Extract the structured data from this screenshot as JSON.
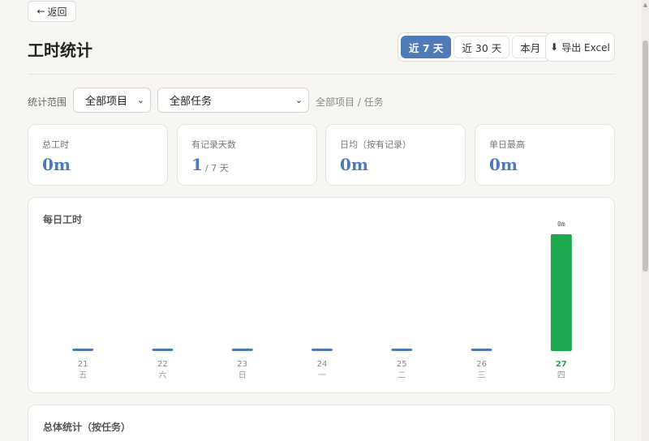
{
  "header": {
    "back_label": "返回",
    "title": "工时统计",
    "range_options": [
      "近 7 天",
      "近 30 天",
      "本月"
    ],
    "active_range": "近 7 天",
    "export_label": "导出 Excel"
  },
  "filters": {
    "label": "统计范围",
    "project_value": "全部项目",
    "task_value": "全部任务",
    "crumb": "全部项目 / 任务"
  },
  "stats": {
    "total": {
      "label": "总工时",
      "value": "0m"
    },
    "days": {
      "label": "有记录天数",
      "value": "1",
      "suffix": "/ 7 天"
    },
    "daily_avg": {
      "label": "日均（按有记录）",
      "value": "0m"
    },
    "max_day": {
      "label": "单日最高",
      "value": "0m"
    }
  },
  "chart": {
    "title": "每日工时",
    "accent_color": "#4f7ab8",
    "highlight_color": "#1ea84e"
  },
  "chart_data": {
    "type": "bar",
    "title": "每日工时",
    "categories": [
      "21",
      "22",
      "23",
      "24",
      "25",
      "26",
      "27"
    ],
    "weekdays": [
      "五",
      "六",
      "日",
      "一",
      "二",
      "三",
      "四"
    ],
    "values": [
      0,
      0,
      0,
      0,
      0,
      0,
      1
    ],
    "data_labels": [
      "",
      "",
      "",
      "",
      "",
      "",
      "0m"
    ],
    "highlight_index": 6,
    "ylim": [
      0,
      1
    ],
    "grid": false
  },
  "total_section": {
    "title": "总体统计（按任务）"
  }
}
